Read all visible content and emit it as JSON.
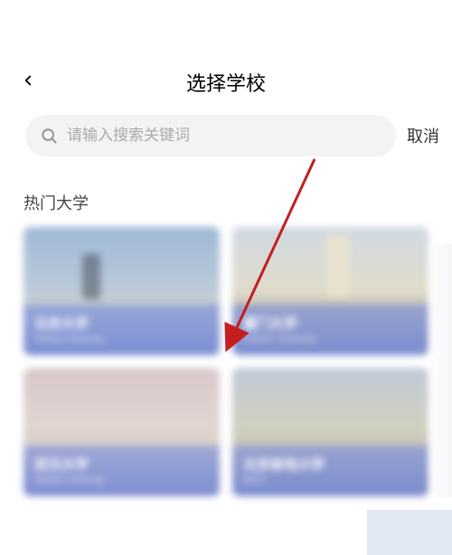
{
  "header": {
    "title": "选择学校"
  },
  "search": {
    "placeholder": "请输入搜索关键词",
    "cancel_label": "取消"
  },
  "section": {
    "title": "热门大学"
  },
  "cards": [
    {
      "title": "北京大学",
      "sub": "Peking University"
    },
    {
      "title": "厦门大学",
      "sub": "Xiamen University"
    },
    {
      "title": "武汉大学",
      "sub": "Wuhan University"
    },
    {
      "title": "北京邮电大学",
      "sub": "BUPT"
    }
  ]
}
